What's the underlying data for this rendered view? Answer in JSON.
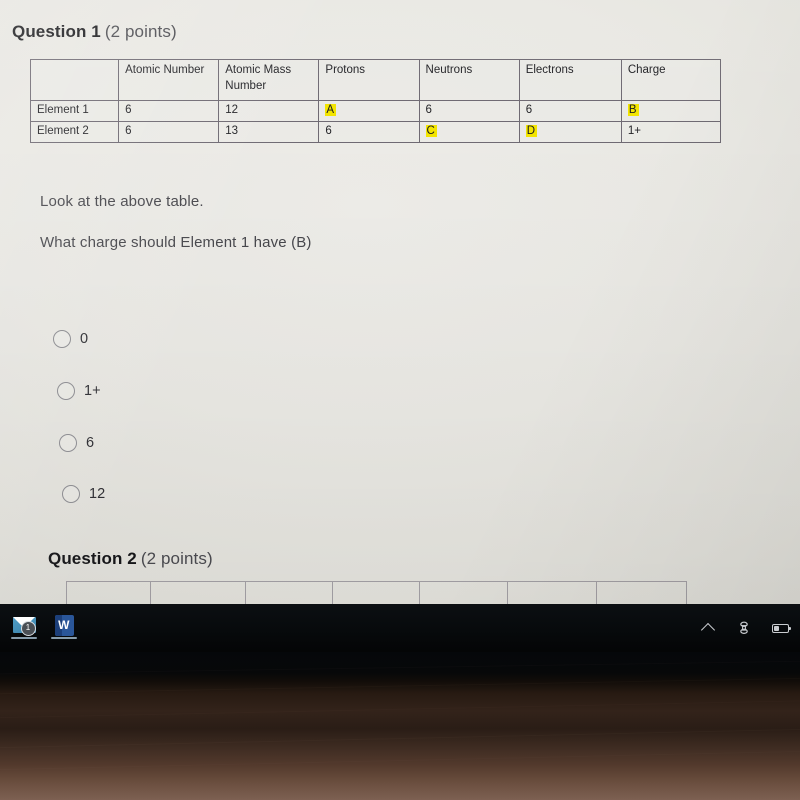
{
  "question1": {
    "label": "Question 1",
    "points": "(2 points)",
    "prompt_line1": "Look at the above table.",
    "prompt_line2": "What charge should Element 1 have (B)",
    "options": [
      {
        "label": "0",
        "selected": false
      },
      {
        "label": "1+",
        "selected": false
      },
      {
        "label": "6",
        "selected": false
      },
      {
        "label": "12",
        "selected": false
      }
    ]
  },
  "table": {
    "headers": [
      "",
      "Atomic Number",
      "Atomic Mass Number",
      "Protons",
      "Neutrons",
      "Electrons",
      "Charge"
    ],
    "rows": [
      {
        "label": "Element 1",
        "atomic_number": "6",
        "atomic_mass_number": "12",
        "protons": "A",
        "neutrons": "6",
        "electrons": "6",
        "charge": "B"
      },
      {
        "label": "Element 2",
        "atomic_number": "6",
        "atomic_mass_number": "13",
        "protons": "6",
        "neutrons": "C",
        "electrons": "D",
        "charge": "1+"
      }
    ],
    "highlighted_cells": [
      "A",
      "B",
      "C",
      "D"
    ],
    "highlight_color": "#f3e500"
  },
  "question2": {
    "label": "Question 2",
    "points": "(2 points)"
  },
  "taskbar": {
    "items": [
      {
        "name": "mail",
        "icon": "mail-icon",
        "badge": "1"
      },
      {
        "name": "word",
        "icon": "word-icon",
        "letter": "W"
      }
    ],
    "tray": [
      {
        "name": "show-hidden-icons",
        "icon": "chevron-up-icon"
      },
      {
        "name": "network",
        "icon": "network-icon"
      },
      {
        "name": "battery",
        "icon": "battery-icon"
      }
    ]
  },
  "colors": {
    "page_background": "#e9e8e3",
    "table_border": "#6f6a73",
    "heading_text": "#17171a",
    "body_text": "#47474c",
    "highlight": "#f3e500",
    "taskbar": "#070a0c"
  }
}
